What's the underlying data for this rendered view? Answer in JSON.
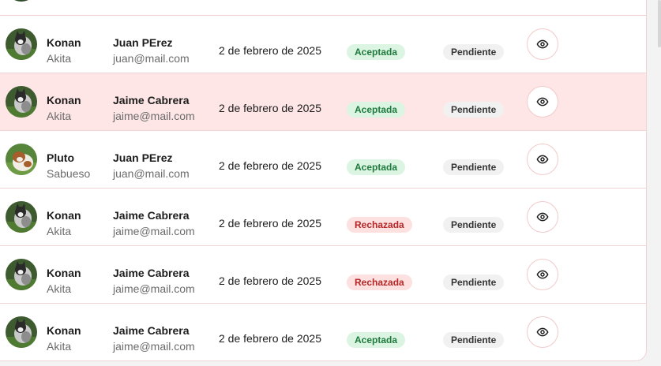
{
  "table": {
    "rows": [
      {
        "pet_name": "Konan",
        "pet_breed": "Akita",
        "owner_name": "Juan PErez",
        "owner_email": "juan@mail.com",
        "date": "2 de febrero de 2025",
        "status": "Aceptada",
        "status_kind": "accepted",
        "payment": "Pendiente",
        "avatar_icon": "akita-dog-photo"
      },
      {
        "pet_name": "Konan",
        "pet_breed": "Akita",
        "owner_name": "Jaime Cabrera",
        "owner_email": "jaime@mail.com",
        "date": "2 de febrero de 2025",
        "status": "Aceptada",
        "status_kind": "accepted",
        "payment": "Pendiente",
        "avatar_icon": "akita-dog-photo"
      },
      {
        "pet_name": "Pluto",
        "pet_breed": "Sabueso",
        "owner_name": "Juan PErez",
        "owner_email": "juan@mail.com",
        "date": "2 de febrero de 2025",
        "status": "Aceptada",
        "status_kind": "accepted",
        "payment": "Pendiente",
        "avatar_icon": "bulldog-photo"
      },
      {
        "pet_name": "Konan",
        "pet_breed": "Akita",
        "owner_name": "Jaime Cabrera",
        "owner_email": "jaime@mail.com",
        "date": "2 de febrero de 2025",
        "status": "Rechazada",
        "status_kind": "rejected",
        "payment": "Pendiente",
        "avatar_icon": "akita-dog-photo"
      },
      {
        "pet_name": "Konan",
        "pet_breed": "Akita",
        "owner_name": "Jaime Cabrera",
        "owner_email": "jaime@mail.com",
        "date": "2 de febrero de 2025",
        "status": "Rechazada",
        "status_kind": "rejected",
        "payment": "Pendiente",
        "avatar_icon": "akita-dog-photo"
      },
      {
        "pet_name": "Konan",
        "pet_breed": "Akita",
        "owner_name": "Jaime Cabrera",
        "owner_email": "jaime@mail.com",
        "date": "2 de febrero de 2025",
        "status": "Aceptada",
        "status_kind": "accepted",
        "payment": "Pendiente",
        "avatar_icon": "akita-dog-photo"
      }
    ],
    "highlighted_row": 1,
    "view_action_icon": "eye-icon"
  },
  "colors": {
    "row_highlight": "#fee6e6",
    "accepted_bg": "#dcf5e3",
    "accepted_text": "#1f7a3d",
    "rejected_bg": "#fde0e0",
    "rejected_text": "#b62626",
    "border": "#f0d4d4"
  }
}
